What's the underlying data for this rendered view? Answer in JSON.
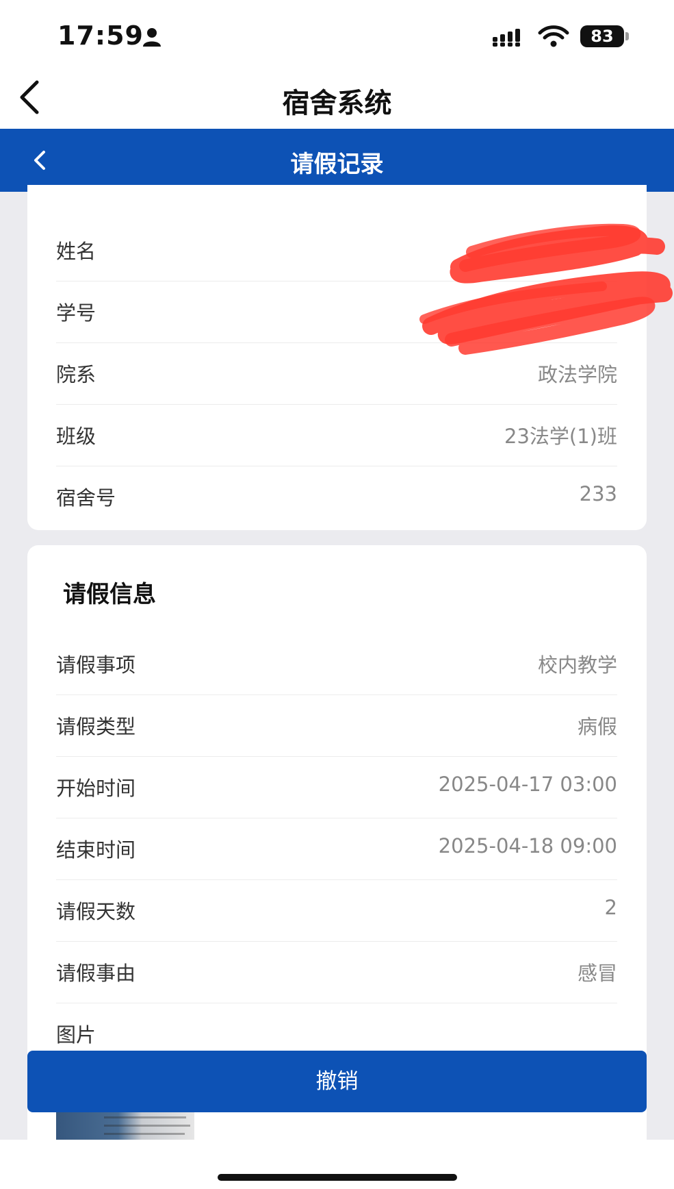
{
  "status_bar": {
    "time": "17:59",
    "battery": "83"
  },
  "app_nav": {
    "title": "宿舍系统"
  },
  "page_header": {
    "title": "请假记录"
  },
  "student_info": {
    "rows": [
      {
        "label": "姓名",
        "value": ""
      },
      {
        "label": "学号",
        "value": ""
      },
      {
        "label": "院系",
        "value": "政法学院"
      },
      {
        "label": "班级",
        "value": "23法学(1)班"
      },
      {
        "label": "宿舍号",
        "value": "233"
      }
    ]
  },
  "leave_info": {
    "heading": "请假信息",
    "rows": [
      {
        "label": "请假事项",
        "value": "校内教学"
      },
      {
        "label": "请假类型",
        "value": "病假"
      },
      {
        "label": "开始时间",
        "value": "2025-04-17 03:00"
      },
      {
        "label": "结束时间",
        "value": "2025-04-18 09:00"
      },
      {
        "label": "请假天数",
        "value": "2"
      },
      {
        "label": "请假事由",
        "value": "感冒"
      },
      {
        "label": "图片",
        "value": ""
      }
    ]
  },
  "actions": {
    "revoke_label": "撤销"
  },
  "colors": {
    "primary": "#0d52b5",
    "background": "#ebebef",
    "redaction": "#ff3b30"
  }
}
